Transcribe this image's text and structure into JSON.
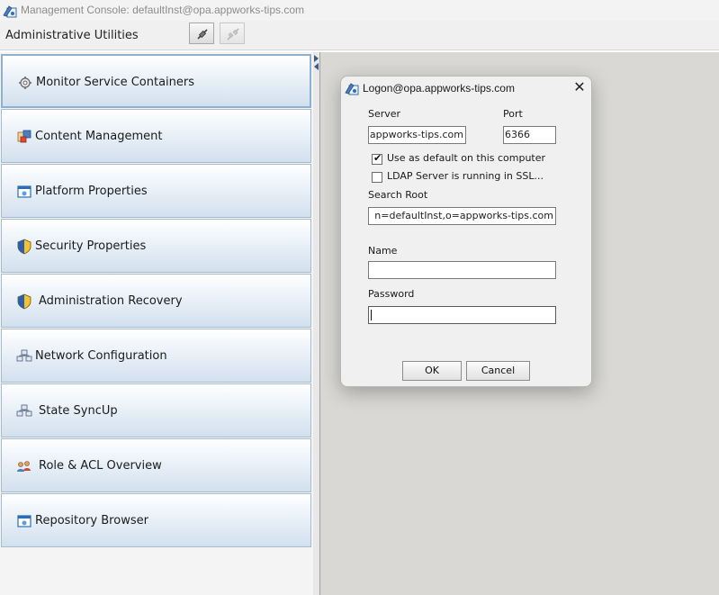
{
  "window": {
    "title": "Management Console: defaultInst@opa.appworks-tips.com",
    "icon": "management-console-icon"
  },
  "toolbar": {
    "title": "Administrative Utilities",
    "buttons": [
      {
        "icon": "connect-icon",
        "enabled": true
      },
      {
        "icon": "disconnect-icon",
        "enabled": false
      }
    ]
  },
  "sidebar": {
    "items": [
      {
        "label": "Monitor Service Containers",
        "icon": "gear-icon",
        "selected": true
      },
      {
        "label": "Content Management",
        "icon": "content-icon"
      },
      {
        "label": "Platform Properties",
        "icon": "window-icon"
      },
      {
        "label": "Security Properties",
        "icon": "shield-icon"
      },
      {
        "label": "Administration Recovery",
        "icon": "shield-icon"
      },
      {
        "label": "Network Configuration",
        "icon": "network-icon"
      },
      {
        "label": "State SyncUp",
        "icon": "network-icon"
      },
      {
        "label": "Role & ACL Overview",
        "icon": "users-icon"
      },
      {
        "label": "Repository Browser",
        "icon": "window-icon"
      }
    ]
  },
  "dialog": {
    "title": "Logon@opa.appworks-tips.com",
    "server_label": "Server",
    "server_value": "appworks-tips.com",
    "port_label": "Port",
    "port_value": "6366",
    "use_default_label": "Use as default on this computer",
    "use_default_checked": true,
    "ldap_ssl_label": "LDAP Server is running in SSL...",
    "ldap_ssl_checked": false,
    "search_root_label": "Search Root",
    "search_root_value": "n=defaultInst,o=appworks-tips.com",
    "name_label": "Name",
    "name_value": "",
    "password_label": "Password",
    "password_value": "",
    "ok_label": "OK",
    "cancel_label": "Cancel",
    "check_mark": "✔",
    "close_glyph": "✕"
  },
  "colors": {
    "content_background": "#d9d8d4",
    "nav_border": "#a9bccd",
    "nav_gradient_bottom": "#d2e0ee",
    "title_text": "#8c8c8c"
  }
}
